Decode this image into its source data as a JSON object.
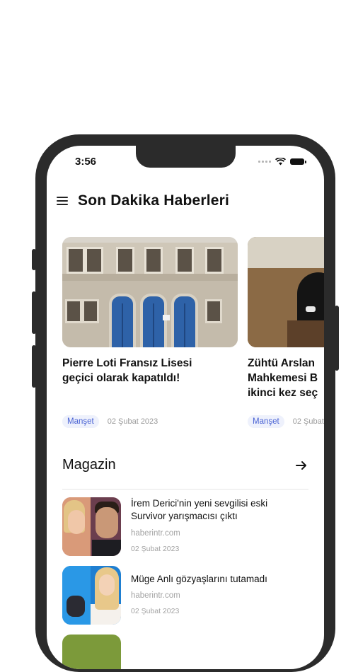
{
  "status_bar": {
    "time": "3:56"
  },
  "header": {
    "title": "Son Dakika Haberleri",
    "menu_icon": "hamburger-menu-icon"
  },
  "carousel": {
    "cards": [
      {
        "title_line1": "Pierre Loti Fransız Lisesi",
        "title_line2": "geçici olarak kapatıldı!",
        "title_line3": "",
        "tag": "Manşet",
        "date": "02 Şubat 2023"
      },
      {
        "title_line1": "Zühtü Arslan",
        "title_line2": "Mahkemesi B",
        "title_line3": "ikinci kez seç",
        "tag": "Manşet",
        "date": "02 Şubat"
      }
    ]
  },
  "section": {
    "title": "Magazin",
    "arrow_icon": "arrow-right-icon"
  },
  "list": {
    "items": [
      {
        "title": "İrem Derici'nin yeni sevgilisi eski Survivor yarışmacısı çıktı",
        "source": "haberintr.com",
        "date": "02 Şubat 2023"
      },
      {
        "title": "Müge Anlı gözyaşlarını tutamadı",
        "source": "haberintr.com",
        "date": "02 Şubat 2023"
      }
    ]
  },
  "colors": {
    "accent": "#4a63d4",
    "tag_bg": "#eef1fc",
    "frame": "#2b2b2b"
  }
}
